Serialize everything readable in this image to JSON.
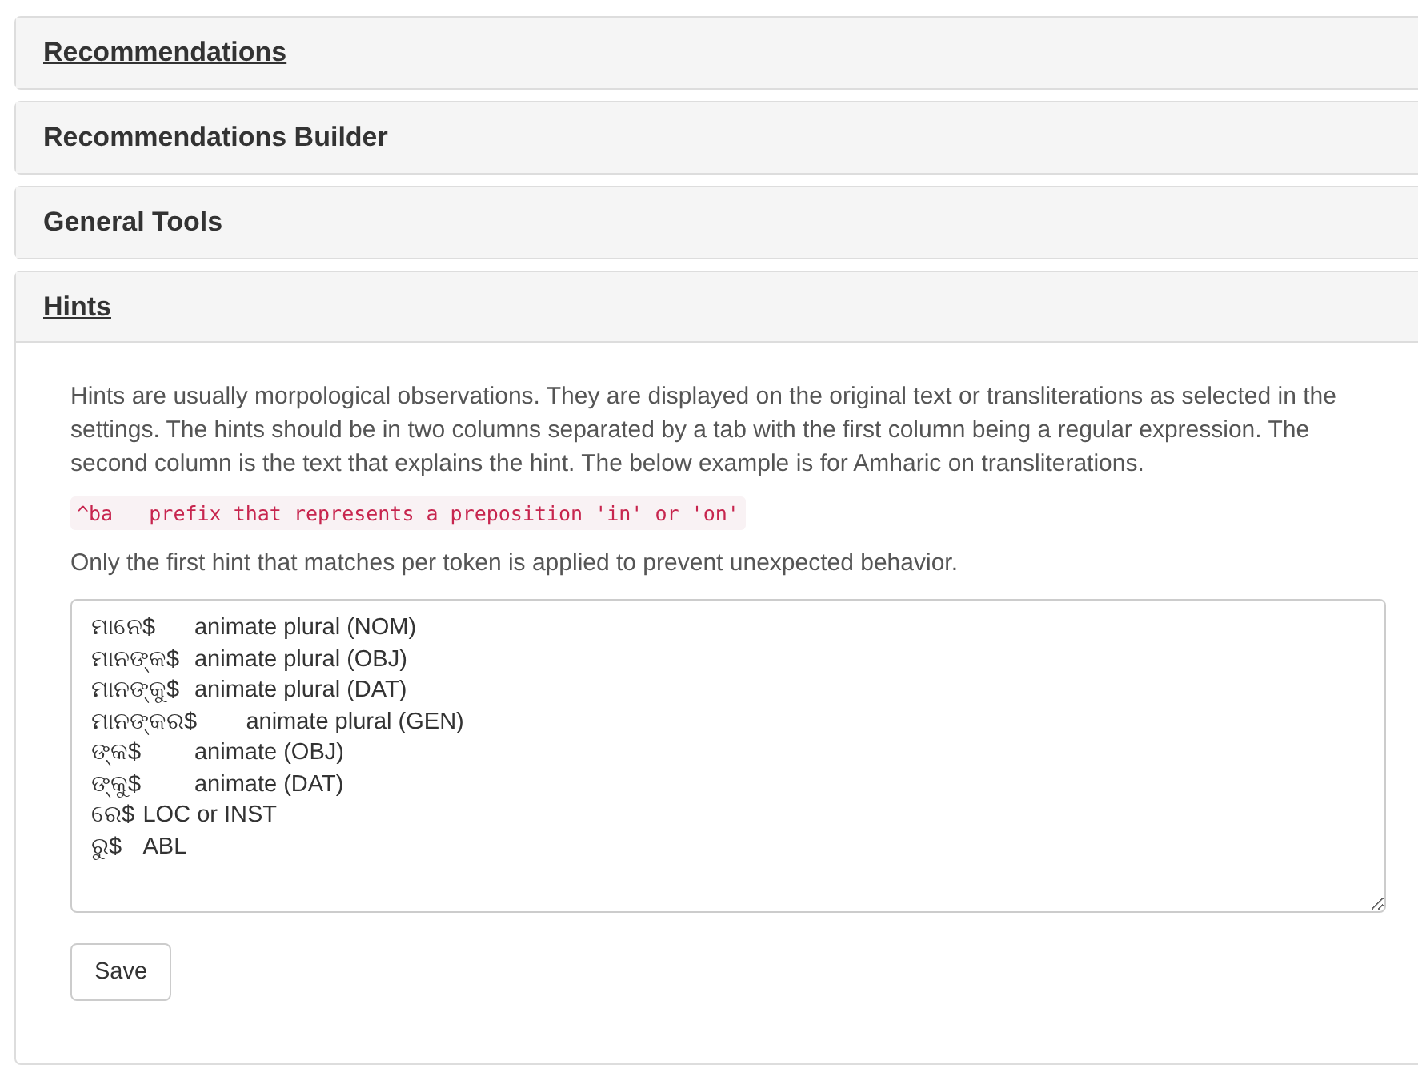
{
  "panels": [
    {
      "title": "Recommendations",
      "underlined": true,
      "expanded": false
    },
    {
      "title": "Recommendations Builder",
      "underlined": false,
      "expanded": false
    },
    {
      "title": "General Tools",
      "underlined": false,
      "expanded": false
    },
    {
      "title": "Hints",
      "underlined": true,
      "expanded": true,
      "intro": "Hints are usually morpological observations. They are displayed on the original text or transliterations as selected in the settings. The hints should be in two columns separated by a tab with the first column being a regular expression. The second column is the text that explains the hint. The below example is for Amharic on transliterations.",
      "example": "^ba   prefix that represents a preposition 'in' or 'on'",
      "note": "Only the first hint that matches per token is applied to prevent unexpected behavior.",
      "value": "ମାନେ$\tanimate plural (NOM)\nମାନଙ୍କ$\tanimate plural (OBJ)\nମାନଙ୍କୁ$\tanimate plural (DAT)\nମାନଙ୍କର$\tanimate plural (GEN)\nଙ୍କ$\tanimate (OBJ)\nଙ୍କୁ$\tanimate (DAT)\nରେ$\tLOC or INST\nରୁ$\tABL",
      "save": "Save"
    }
  ]
}
